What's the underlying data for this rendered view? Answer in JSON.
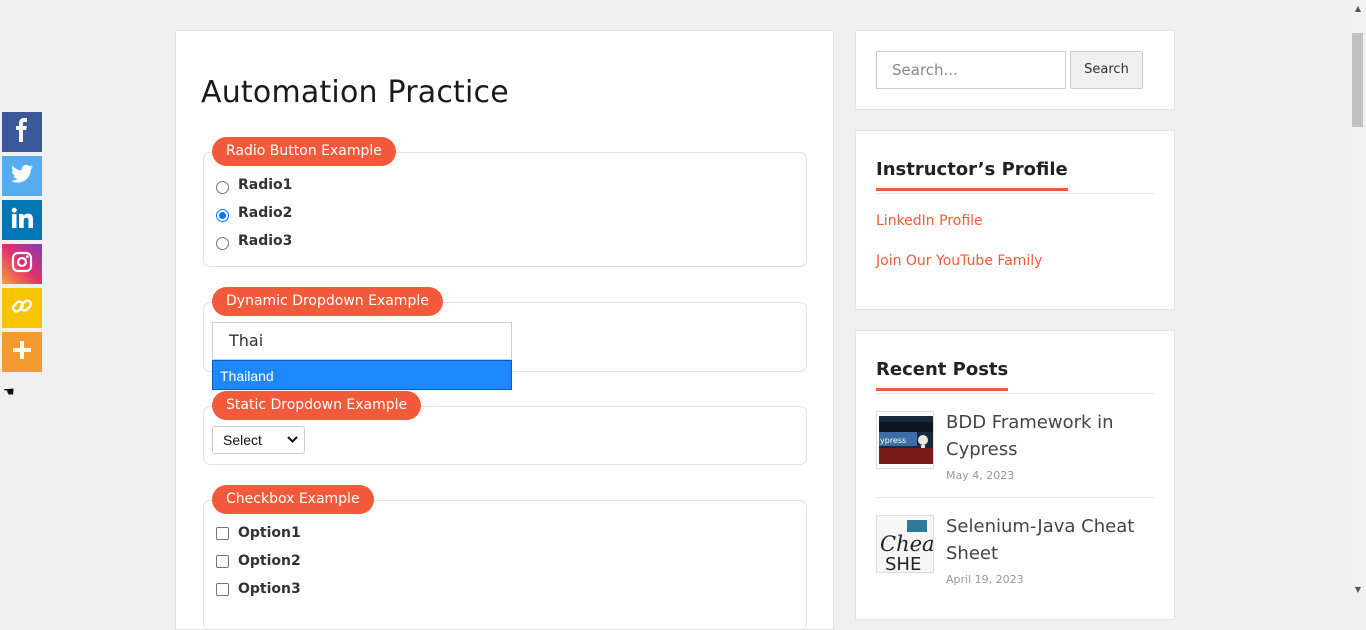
{
  "social": {
    "items": [
      {
        "name": "facebook-icon",
        "color": "#3b5998"
      },
      {
        "name": "twitter-icon",
        "color": "#55acee"
      },
      {
        "name": "linkedin-icon",
        "color": "#0077b5"
      },
      {
        "name": "instagram-icon",
        "color": "#c13584"
      },
      {
        "name": "link-icon",
        "color": "#f6c500"
      },
      {
        "name": "more-icon",
        "color": "#f09a2f"
      }
    ],
    "hide_glyph": "☚"
  },
  "main": {
    "title": "Automation Practice",
    "radio": {
      "legend": "Radio Button Example",
      "options": [
        "Radio1",
        "Radio2",
        "Radio3"
      ],
      "selected": "Radio2"
    },
    "dynamic": {
      "legend": "Dynamic Dropdown Example",
      "input_value": "Thai",
      "suggestion": "Thailand"
    },
    "static": {
      "legend": "Static Dropdown Example",
      "selected": "Select"
    },
    "checkbox": {
      "legend": "Checkbox Example",
      "options": [
        "Option1",
        "Option2",
        "Option3"
      ]
    }
  },
  "sidebar": {
    "search": {
      "placeholder": "Search...",
      "button": "Search"
    },
    "instructor": {
      "title": "Instructor’s Profile",
      "links": [
        "LinkedIn Profile",
        "Join Our YouTube Family"
      ]
    },
    "recent": {
      "title": "Recent Posts",
      "posts": [
        {
          "title": "BDD Framework in Cypress",
          "date": "May 4, 2023",
          "thumb_text": "ypress"
        },
        {
          "title": "Selenium-Java Cheat Sheet",
          "date": "April 19, 2023",
          "thumb_text": "Cheat SHE"
        }
      ]
    }
  },
  "colors": {
    "accent": "#f25a3b",
    "selection": "#1e88ff",
    "radio": "#0075ff"
  }
}
